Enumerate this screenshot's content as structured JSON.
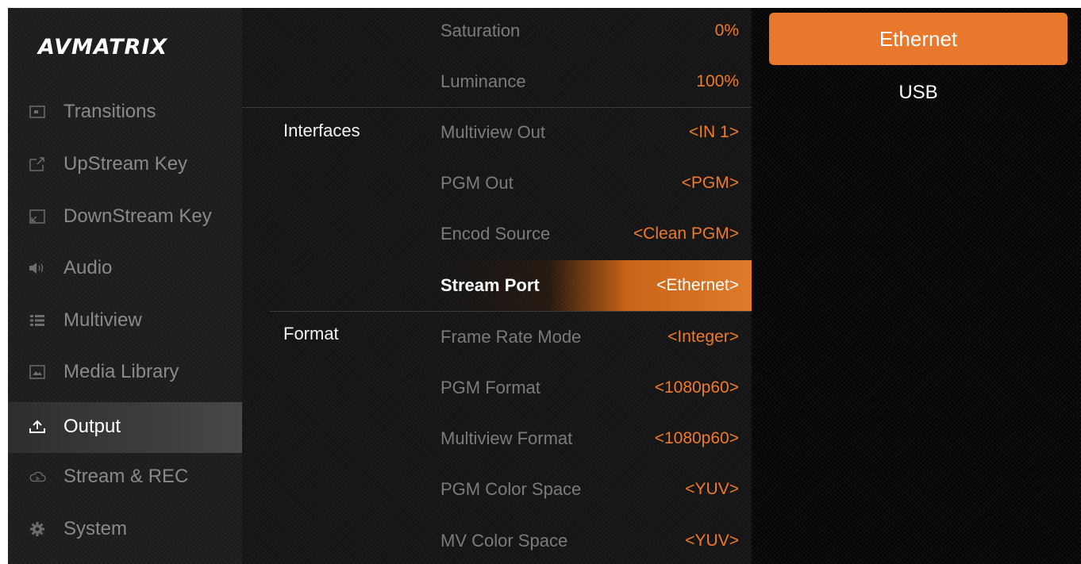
{
  "logo": "AVMATRIX",
  "sidebar": {
    "items": [
      {
        "label": "Transitions",
        "icon": "transitions-icon"
      },
      {
        "label": "UpStream Key",
        "icon": "upstream-key-icon"
      },
      {
        "label": "DownStream Key",
        "icon": "downstream-key-icon"
      },
      {
        "label": "Audio",
        "icon": "audio-icon"
      },
      {
        "label": "Multiview",
        "icon": "multiview-icon"
      },
      {
        "label": "Media Library",
        "icon": "media-library-icon"
      },
      {
        "label": "Output",
        "icon": "output-icon",
        "active": true
      },
      {
        "label": "Stream & REC",
        "icon": "cloud-icon"
      },
      {
        "label": "System",
        "icon": "gear-icon"
      }
    ]
  },
  "middle": {
    "top_rows": [
      {
        "label": "Saturation",
        "value": "0%"
      },
      {
        "label": "Luminance",
        "value": "100%"
      }
    ],
    "interfaces": {
      "label": "Interfaces",
      "rows": [
        {
          "label": "Multiview Out",
          "value": "<IN 1>"
        },
        {
          "label": "PGM Out",
          "value": "<PGM>"
        },
        {
          "label": "Encod Source",
          "value": "<Clean PGM>"
        },
        {
          "label": "Stream Port",
          "value": "<Ethernet>",
          "selected": true
        }
      ]
    },
    "format": {
      "label": "Format",
      "rows": [
        {
          "label": "Frame Rate Mode",
          "value": "<Integer>"
        },
        {
          "label": "PGM Format",
          "value": "<1080p60>"
        },
        {
          "label": "Multiview Format",
          "value": "<1080p60>"
        },
        {
          "label": "PGM Color Space",
          "value": "<YUV>"
        },
        {
          "label": "MV Color Space",
          "value": "<YUV>"
        }
      ]
    }
  },
  "options": [
    {
      "label": "Ethernet",
      "selected": true
    },
    {
      "label": "USB"
    }
  ],
  "colors": {
    "accent": "#e8782c",
    "value_text": "#f07a2a"
  }
}
